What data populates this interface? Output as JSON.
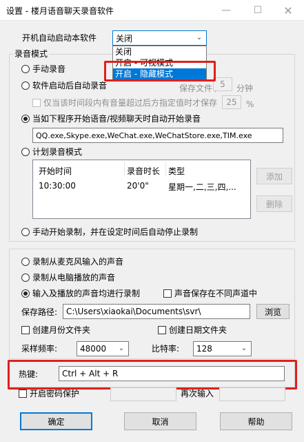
{
  "window": {
    "title": "设置 - 楼月语音聊天录音软件"
  },
  "startup": {
    "label": "开机自动启动本软件",
    "selected": "关闭",
    "options": [
      "关闭",
      "开启 - 可视模式",
      "开启 - 隐藏模式"
    ]
  },
  "record_mode": {
    "group_title": "录音模式",
    "manual": "手动录音",
    "auto_after_start": "软件启动后自动录音",
    "save_file_label": "保存文件 /",
    "save_file_value": "5",
    "save_file_unit": "分钟",
    "only_when_sound": "仅当该时间段内有音量超过后方指定值时才保存",
    "volume_value": "25",
    "volume_unit": "%",
    "auto_when_program": "当如下程序开始语音/视频聊天时自动开始录音",
    "programs": "QQ.exe,Skype.exe,WeChat.exe,WeChatStore.exe,TIM.exe",
    "scheduled": "计划录音模式",
    "schedule_columns": [
      "开始时间",
      "录音时长",
      "类型"
    ],
    "schedule_rows": [
      {
        "start": "10:30:00",
        "duration": "20'0\"",
        "type": "星期一,二,三,四,..."
      }
    ],
    "add_button": "添加",
    "delete_button": "删除",
    "manual_start_auto_stop": "手动开始录制，并在设定时间后自动停止录制"
  },
  "source": {
    "mic": "录制从麦克风输入的声音",
    "speaker": "录制从电脑播放的声音",
    "both": "输入及播放的声音均进行录制",
    "separate_channels": "声音保存在不同声道中",
    "save_path_label": "保存路径:",
    "save_path_value": "C:\\Users\\xiaokai\\Documents\\svr\\",
    "browse_button": "浏览",
    "month_folder": "创建月份文件夹",
    "date_folder": "创建日期文件夹",
    "sample_rate_label": "采样频率:",
    "sample_rate_value": "48000",
    "bitrate_label": "比特率:",
    "bitrate_value": "128"
  },
  "hotkey": {
    "label": "热键:",
    "value": "Ctrl + Alt + R"
  },
  "password": {
    "enable": "开启密码保护",
    "repeat_label": "再次输入"
  },
  "buttons": {
    "ok": "确定",
    "cancel": "取消",
    "help": "帮助"
  },
  "colors": {
    "highlight": "#e0201b",
    "selection": "#0078d7"
  }
}
